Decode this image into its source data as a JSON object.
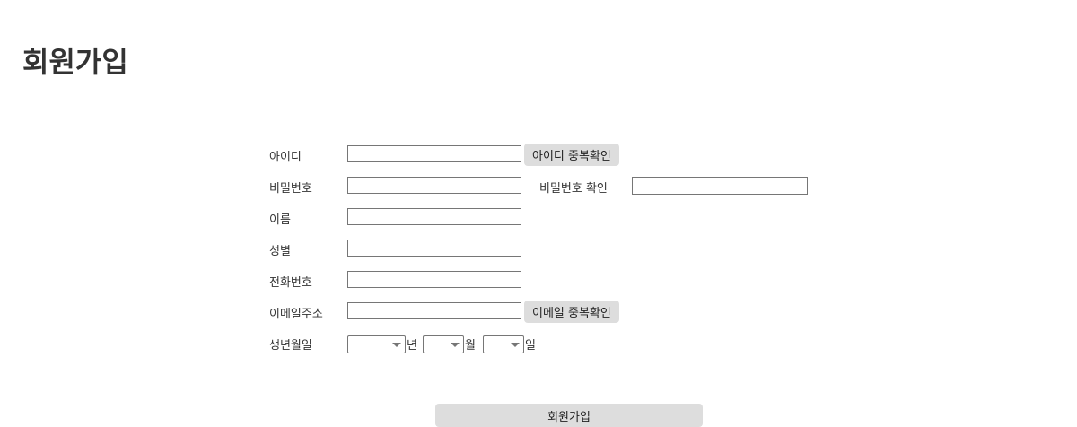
{
  "page": {
    "title": "회원가입"
  },
  "form": {
    "id": {
      "label": "아이디",
      "value": "",
      "check_button": "아이디 중복확인"
    },
    "password": {
      "label": "비밀번호",
      "value": ""
    },
    "password_confirm": {
      "label": "비밀번호 확인",
      "value": ""
    },
    "name": {
      "label": "이름",
      "value": ""
    },
    "gender": {
      "label": "성별",
      "value": ""
    },
    "phone": {
      "label": "전화번호",
      "value": ""
    },
    "email": {
      "label": "이메일주소",
      "value": "",
      "check_button": "이메일 중복확인"
    },
    "birth": {
      "label": "생년월일",
      "year": {
        "selected": "",
        "unit": "년"
      },
      "month": {
        "selected": "",
        "unit": "월"
      },
      "day": {
        "selected": "",
        "unit": "일"
      }
    },
    "submit_label": "회원가입"
  }
}
